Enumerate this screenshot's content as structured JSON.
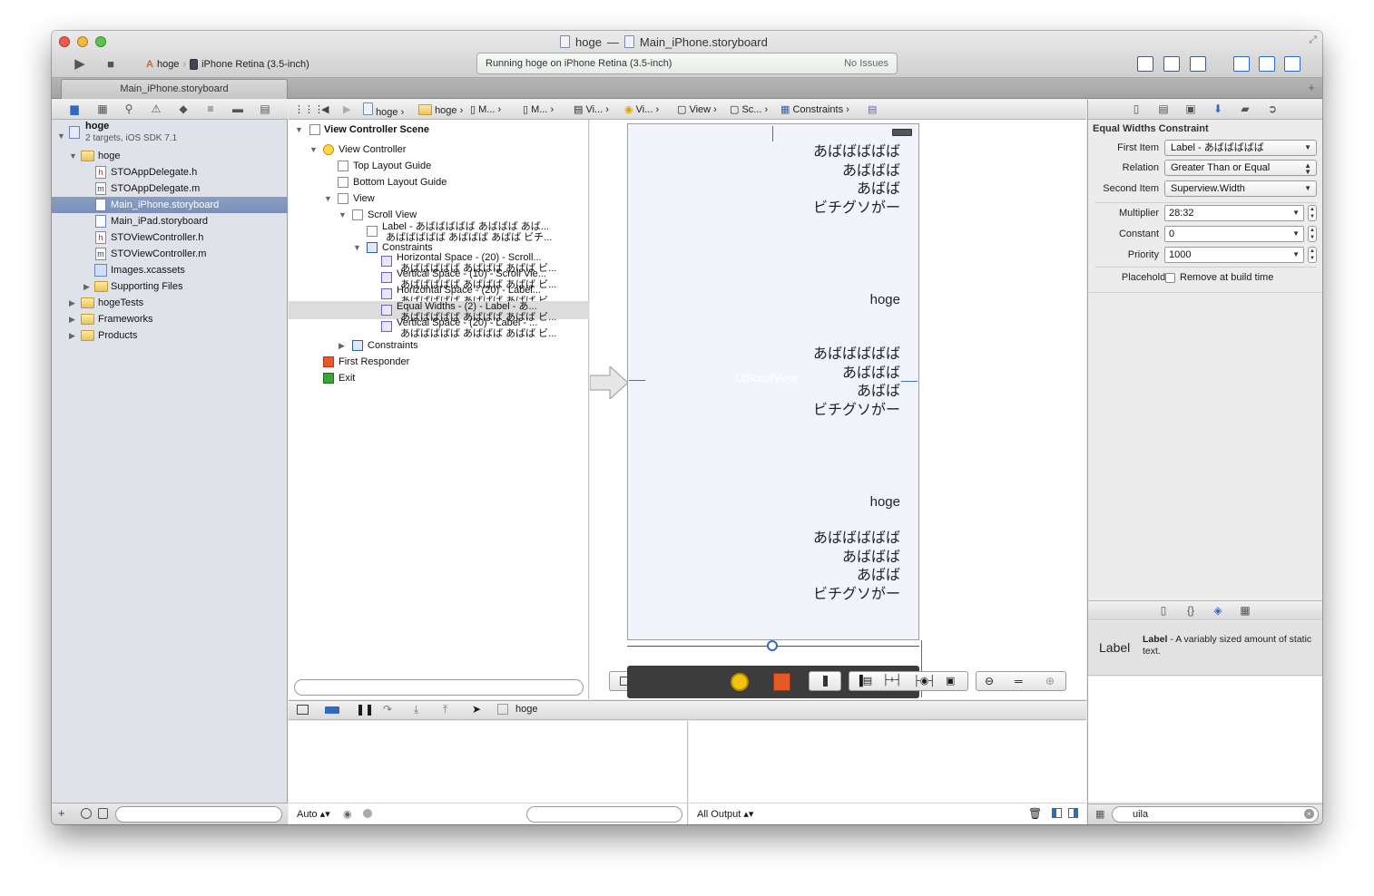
{
  "window": {
    "project": "hoge",
    "title_separator": "—",
    "document": "Main_iPhone.storyboard"
  },
  "toolbar": {
    "scheme": "hoge",
    "destination": "iPhone Retina (3.5-inch)",
    "status_text": "Running hoge on iPhone Retina (3.5-inch)",
    "issues_text": "No Issues"
  },
  "tab": {
    "label": "Main_iPhone.storyboard",
    "add": "+"
  },
  "navigator": {
    "project_name": "hoge",
    "project_sub": "2 targets, iOS SDK 7.1",
    "group": "hoge",
    "files": [
      "STOAppDelegate.h",
      "STOAppDelegate.m",
      "Main_iPhone.storyboard",
      "Main_iPad.storyboard",
      "STOViewController.h",
      "STOViewController.m",
      "Images.xcassets",
      "Supporting Files"
    ],
    "groups": [
      "hogeTests",
      "Frameworks",
      "Products"
    ],
    "add": "+"
  },
  "jumpbar": {
    "crumbs": [
      "hoge",
      "hoge",
      "M...",
      "M...",
      "Vi...",
      "Vi...",
      "View",
      "Sc...",
      "Constraints"
    ]
  },
  "outline": {
    "scene": "View Controller Scene",
    "view_controller": "View Controller",
    "top_guide": "Top Layout Guide",
    "bottom_guide": "Bottom Layout Guide",
    "view": "View",
    "scroll_view": "Scroll View",
    "label_line1": "Label - あばばばばば あばばば あば...",
    "label_line2": "あばばばばば あばばば あばば ビチ...",
    "constraints": "Constraints",
    "c1": "Horizontal Space - (20) - Scroll...",
    "c1b": "あばばばばば あばばば あばば ビ...",
    "c2": "Vertical Space - (10) - Scroll Vie...",
    "c2b": "あばばばばば あばばば あばば ビ...",
    "c3": "Horizontal Space - (20) - Label...",
    "c3b": "あばばばばば あばばば あばば ビ...",
    "c4": "Equal Widths - (2) - Label - あ...",
    "c4b": "あばばばばば あばばば あばば ビ...",
    "c5": "Vertical Space - (20) - Label - ...",
    "c5b": "あばばばばば あばばば あばば ビ...",
    "view_constraints": "Constraints",
    "first_responder": "First Responder",
    "exit": "Exit"
  },
  "canvas": {
    "label_block": "あばばばばば\nあばばば\nあばば\nビチグソがー",
    "hoge": "hoge",
    "scroll_hint": "UIScrollView"
  },
  "debug": {
    "target": "hoge",
    "auto": "Auto ▴▾",
    "all_output": "All Output ▴▾"
  },
  "inspector": {
    "section_title": "Equal Widths Constraint",
    "first_item_label": "First Item",
    "first_item_value": "Label - あばばばばば",
    "relation_label": "Relation",
    "relation_value": "Greater Than or Equal",
    "second_item_label": "Second Item",
    "second_item_value": "Superview.Width",
    "multiplier_label": "Multiplier",
    "multiplier_value": "28:32",
    "constant_label": "Constant",
    "constant_value": "0",
    "priority_label": "Priority",
    "priority_value": "1000",
    "placeholder_label": "Placeholder",
    "placeholder_text": "Remove at build time",
    "library_item_icon_text": "Label",
    "library_item_title": "Label",
    "library_item_desc": " - A variably sized amount of static text.",
    "search_value": "uila"
  },
  "colors": {
    "selection": "#7b90b8",
    "accent": "#2d6bc2",
    "folder": "#e7c560"
  }
}
